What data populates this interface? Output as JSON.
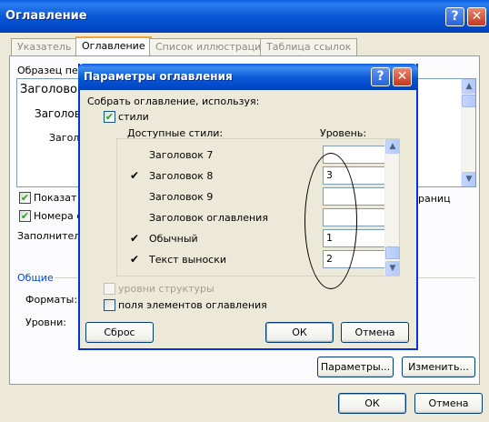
{
  "outer_dialog": {
    "title": "Оглавление",
    "tabs": [
      {
        "label": "Указатель",
        "active": false
      },
      {
        "label": "Оглавление",
        "active": true
      },
      {
        "label": "Список иллюстраций",
        "active": false
      },
      {
        "label": "Таблица ссылок",
        "active": false
      }
    ],
    "preview_label": "Образец печа",
    "preview_lines": [
      "Заголовок",
      "Заголовок",
      "Загол"
    ],
    "show_checkbox_label": "Показат",
    "page_numbers_checkbox_label": "Номера ст",
    "filler_label": "Заполнитель",
    "hyperlinks_truncated": "раниц",
    "general_group": "Общие",
    "formats_label": "Форматы:",
    "levels_label": "Уровни:",
    "params_button": "Параметры...",
    "modify_button": "Изменить...",
    "ok_button": "ОК",
    "cancel_button": "Отмена"
  },
  "options_dialog": {
    "title": "Параметры оглавления",
    "build_from_label": "Собрать оглавление, используя:",
    "styles_checkbox": {
      "label": "стили",
      "checked": true
    },
    "available_styles_header": "Доступные стили:",
    "level_header": "Уровень:",
    "styles": [
      {
        "name": "Заголовок 7",
        "checked": false,
        "level": ""
      },
      {
        "name": "Заголовок 8",
        "checked": true,
        "level": "3"
      },
      {
        "name": "Заголовок 9",
        "checked": false,
        "level": ""
      },
      {
        "name": "Заголовок оглавления",
        "checked": false,
        "level": ""
      },
      {
        "name": "Обычный",
        "checked": true,
        "level": "1"
      },
      {
        "name": "Текст выноски",
        "checked": true,
        "level": "2"
      }
    ],
    "outline_levels_checkbox": {
      "label": "уровни структуры",
      "checked": false,
      "enabled": false
    },
    "toc_fields_checkbox": {
      "label": "поля элементов оглавления",
      "checked": false
    },
    "reset_button": "Сброс",
    "ok_button": "ОК",
    "cancel_button": "Отмена"
  },
  "icons": {
    "help": "?",
    "close": "✕",
    "check": "✔",
    "scroll_up": "▲",
    "scroll_down": "▼"
  },
  "colors": {
    "title_bar": "#0b58d6",
    "close_button": "#c13a1c",
    "annotation": "#000000"
  }
}
